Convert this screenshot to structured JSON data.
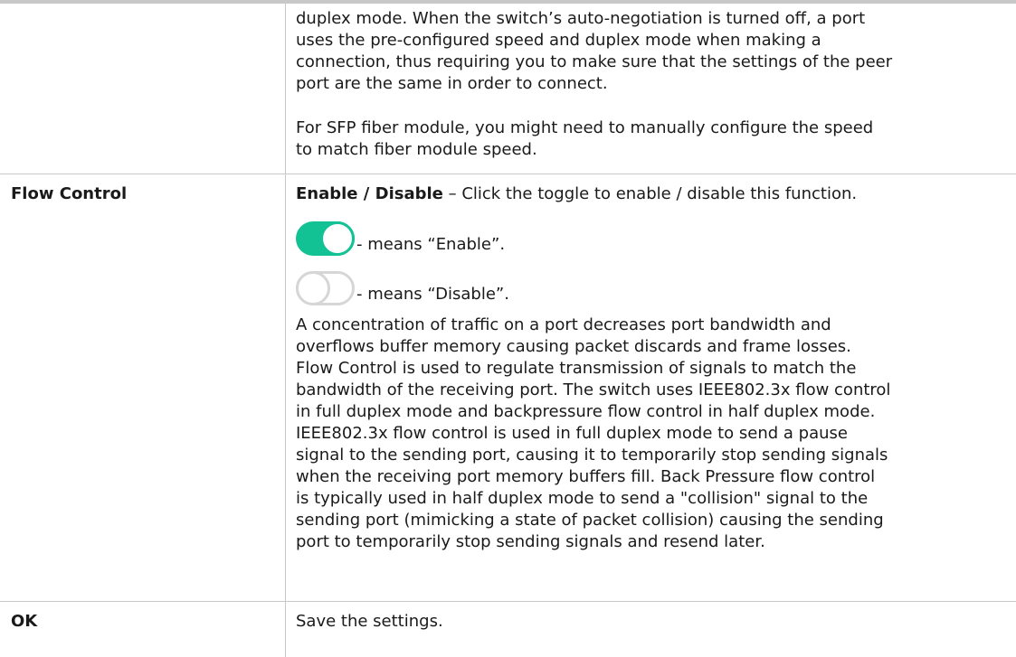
{
  "row_continued": {
    "description_lines": [
      "duplex mode. When the switch’s auto-negotiation is turned off, a port",
      "uses the pre-configured speed and duplex mode when making a",
      "connection, thus requiring you to make sure that the settings of the peer",
      "port are the same in order to connect."
    ],
    "sfp_note_lines": [
      "For SFP fiber module, you might need to manually configure the speed",
      "to match fiber module speed."
    ]
  },
  "flow_control": {
    "label": "Flow Control",
    "enable_disable_bold": "Enable / Disable",
    "enable_disable_rest": " – Click the toggle to enable / disable this function.",
    "toggle_on_text": "- means “Enable”.",
    "toggle_off_text": "- means “Disable”.",
    "toggle_on_color": "#13c294",
    "toggle_off_color": "#d6d6d6",
    "paragraph_lines": [
      "A concentration of traffic on a port decreases port bandwidth and",
      "overflows buffer memory causing packet discards and frame losses.",
      "Flow Control is used to regulate transmission of signals to match the",
      "bandwidth of the receiving port. The switch uses IEEE802.3x flow control",
      "in full duplex mode and backpressure flow control in half duplex mode.",
      "IEEE802.3x flow control is used in full duplex mode to send a pause",
      "signal to the sending port, causing it to temporarily stop sending signals",
      "when the receiving port memory buffers fill. Back Pressure flow control",
      "is typically used in half duplex mode to send a \"collision\" signal to the",
      "sending port (mimicking a state of packet collision) causing the sending",
      "port to temporarily stop sending signals and resend later."
    ]
  },
  "ok_row": {
    "label": "OK",
    "description": "Save the settings."
  }
}
